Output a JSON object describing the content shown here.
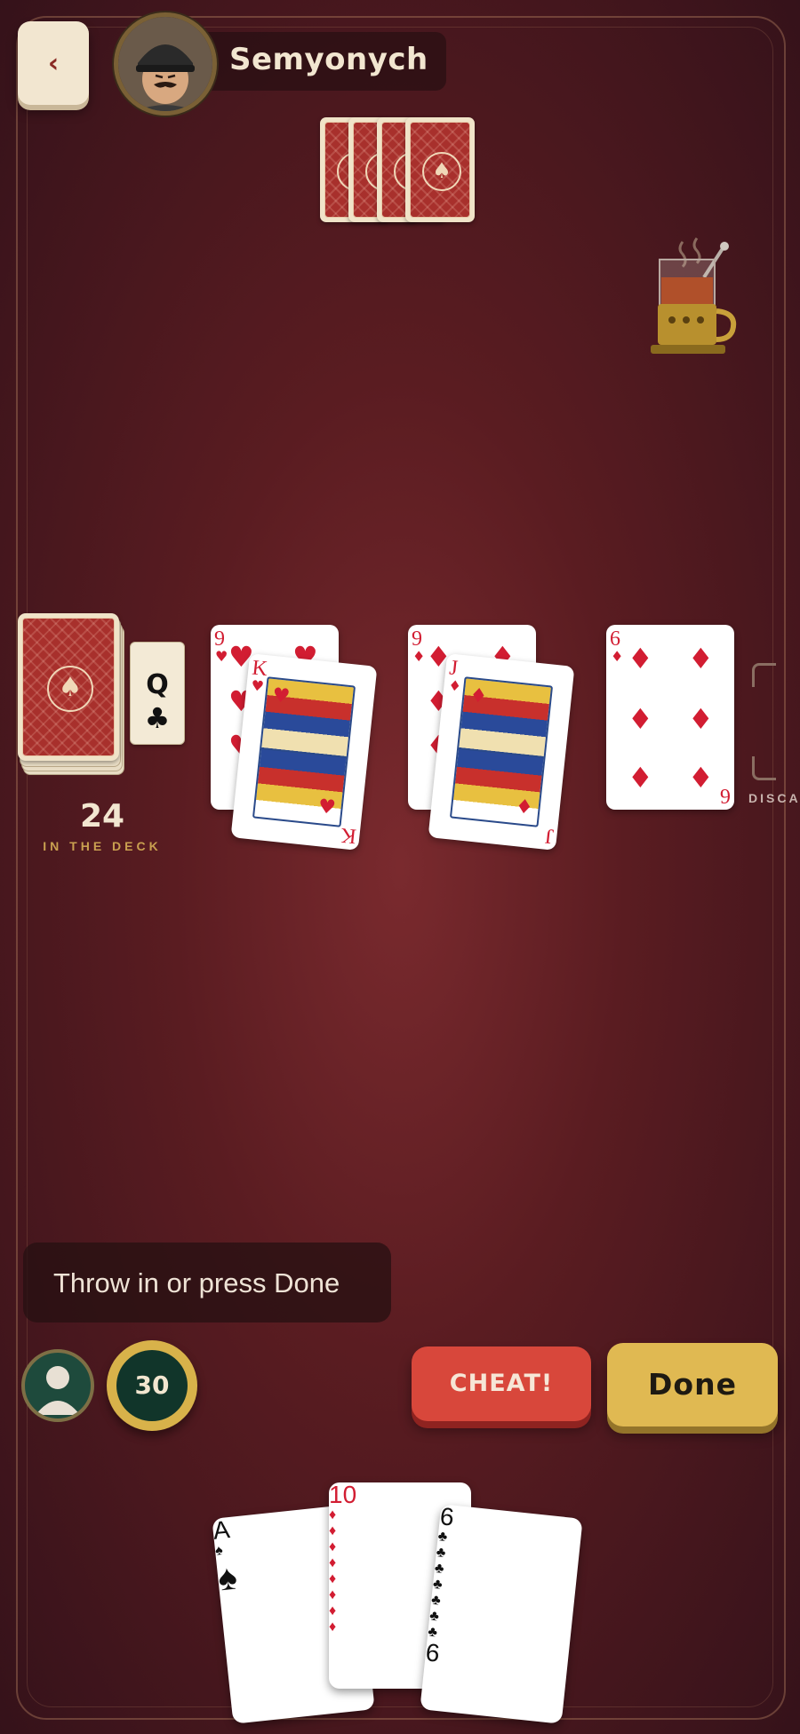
{
  "opponent": {
    "name": "Semyonych",
    "cards_count": 4
  },
  "back_button": {
    "icon": "chevron-left-icon",
    "glyph": "‹"
  },
  "deck": {
    "count": "24",
    "label": "IN THE DECK",
    "trump_rank": "Q",
    "trump_suit": "♣"
  },
  "table_pairs": [
    {
      "attack": {
        "rank": "9",
        "suit": "♥"
      },
      "defense": {
        "rank": "K",
        "suit": "♥"
      }
    },
    {
      "attack": {
        "rank": "9",
        "suit": "♦"
      },
      "defense": {
        "rank": "J",
        "suit": "♦"
      }
    },
    {
      "attack": {
        "rank": "6",
        "suit": "♦"
      },
      "defense": null
    }
  ],
  "discard_label": "DISCA",
  "hint": "Throw in or press Done",
  "timer": "30",
  "buttons": {
    "cheat": "CHEAT!",
    "done": "Done"
  },
  "hand": [
    {
      "rank": "A",
      "suit": "♠"
    },
    {
      "rank": "10",
      "suit": "♦"
    },
    {
      "rank": "6",
      "suit": "♣"
    }
  ],
  "colors": {
    "felt": "#5a1c21",
    "red_suit": "#d21d32",
    "gold": "#e0b952",
    "cheat": "#d8473b"
  }
}
